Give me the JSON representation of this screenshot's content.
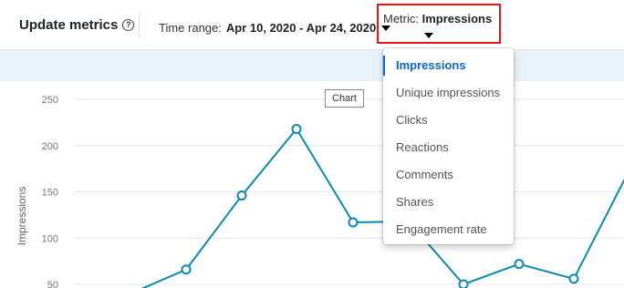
{
  "header": {
    "title": "Update metrics",
    "help_icon_glyph": "?",
    "time_range_label": "Time range:",
    "time_range_value": "Apr 10, 2020 - Apr 24, 2020",
    "metric_label": "Metric:",
    "metric_value": "Impressions"
  },
  "tooltip": "Chart",
  "dropdown": {
    "items": [
      "Impressions",
      "Unique impressions",
      "Clicks",
      "Reactions",
      "Comments",
      "Shares",
      "Engagement rate"
    ],
    "selected_index": 0
  },
  "colors": {
    "accent": "#0a66c2",
    "line": "#0e88b0",
    "highlight_border": "#e3151b",
    "band": "#e8f1f8"
  },
  "chart_data": {
    "type": "line",
    "ylabel": "Impressions",
    "yticks": [
      250,
      200,
      150,
      100,
      50
    ],
    "ylim": [
      50,
      250
    ],
    "grid": true,
    "series": [
      {
        "values": [
          40,
          66,
          146,
          218,
          117,
          118,
          50,
          72,
          56,
          170
        ]
      }
    ]
  }
}
